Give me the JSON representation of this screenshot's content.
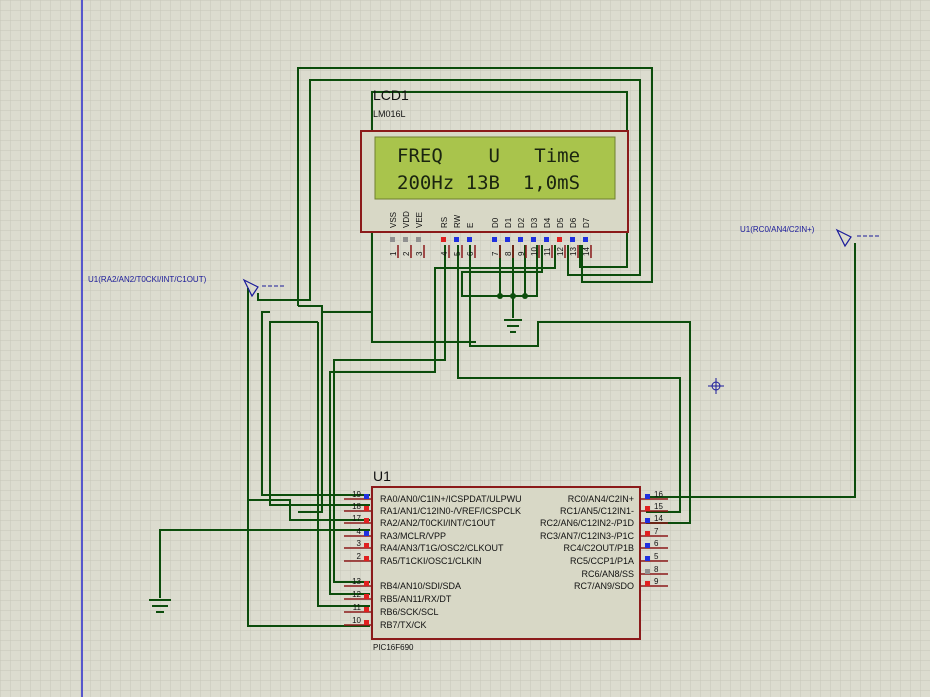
{
  "lcd": {
    "ref": "LCD1",
    "model": "LM016L",
    "line1": "FREQ    U   Time",
    "line2": "200Hz 13B  1,0mS",
    "pin_names": [
      "VSS",
      "VDD",
      "VEE",
      "RS",
      "RW",
      "E",
      "D0",
      "D1",
      "D2",
      "D3",
      "D4",
      "D5",
      "D6",
      "D7"
    ],
    "pin_numbers": [
      "1",
      "2",
      "3",
      "4",
      "5",
      "6",
      "7",
      "8",
      "9",
      "10",
      "11",
      "12",
      "13",
      "14"
    ]
  },
  "mcu": {
    "ref": "U1",
    "part": "PIC16F690",
    "left_pins": [
      {
        "num": "19",
        "name": "RA0/AN0/C1IN+/ICSPDAT/ULPWU"
      },
      {
        "num": "18",
        "name": "RA1/AN1/C12IN0-/VREF/ICSPCLK"
      },
      {
        "num": "17",
        "name": "RA2/AN2/T0CKI/INT/C1OUT"
      },
      {
        "num": "4",
        "name": "RA3/MCLR/VPP"
      },
      {
        "num": "3",
        "name": "RA4/AN3/T1G/OSC2/CLKOUT"
      },
      {
        "num": "2",
        "name": "RA5/T1CKI/OSC1/CLKIN"
      },
      {
        "num": "13",
        "name": "RB4/AN10/SDI/SDA"
      },
      {
        "num": "12",
        "name": "RB5/AN11/RX/DT"
      },
      {
        "num": "11",
        "name": "RB6/SCK/SCL"
      },
      {
        "num": "10",
        "name": "RB7/TX/CK"
      }
    ],
    "right_pins": [
      {
        "num": "16",
        "name": "RC0/AN4/C2IN+"
      },
      {
        "num": "15",
        "name": "RC1/AN5/C12IN1-"
      },
      {
        "num": "14",
        "name": "RC2/AN6/C12IN2-/P1D"
      },
      {
        "num": "7",
        "name": "RC3/AN7/C12IN3-/P1C"
      },
      {
        "num": "6",
        "name": "RC4/C2OUT/P1B"
      },
      {
        "num": "5",
        "name": "RC5/CCP1/P1A"
      },
      {
        "num": "8",
        "name": "RC6/AN8/SS"
      },
      {
        "num": "9",
        "name": "RC7/AN9/SDO"
      }
    ]
  },
  "probes": {
    "left": "U1(RA2/AN2/T0CKI/INT/C1OUT)",
    "right": "U1(RC0/AN4/C2IN+)"
  },
  "colors": {
    "background": "#dcdccf",
    "grid": "#c9c9bb",
    "wire": "#0c4d0c",
    "component_border": "#8b1a1a",
    "component_fill": "#d8d8c6",
    "lcd_screen": "#a9c44c",
    "lcd_text": "#1a2410",
    "pin_red": "#e02020",
    "pin_blue": "#2030e0",
    "pin_gray": "#909090",
    "label_blue": "#1a1a9a"
  }
}
